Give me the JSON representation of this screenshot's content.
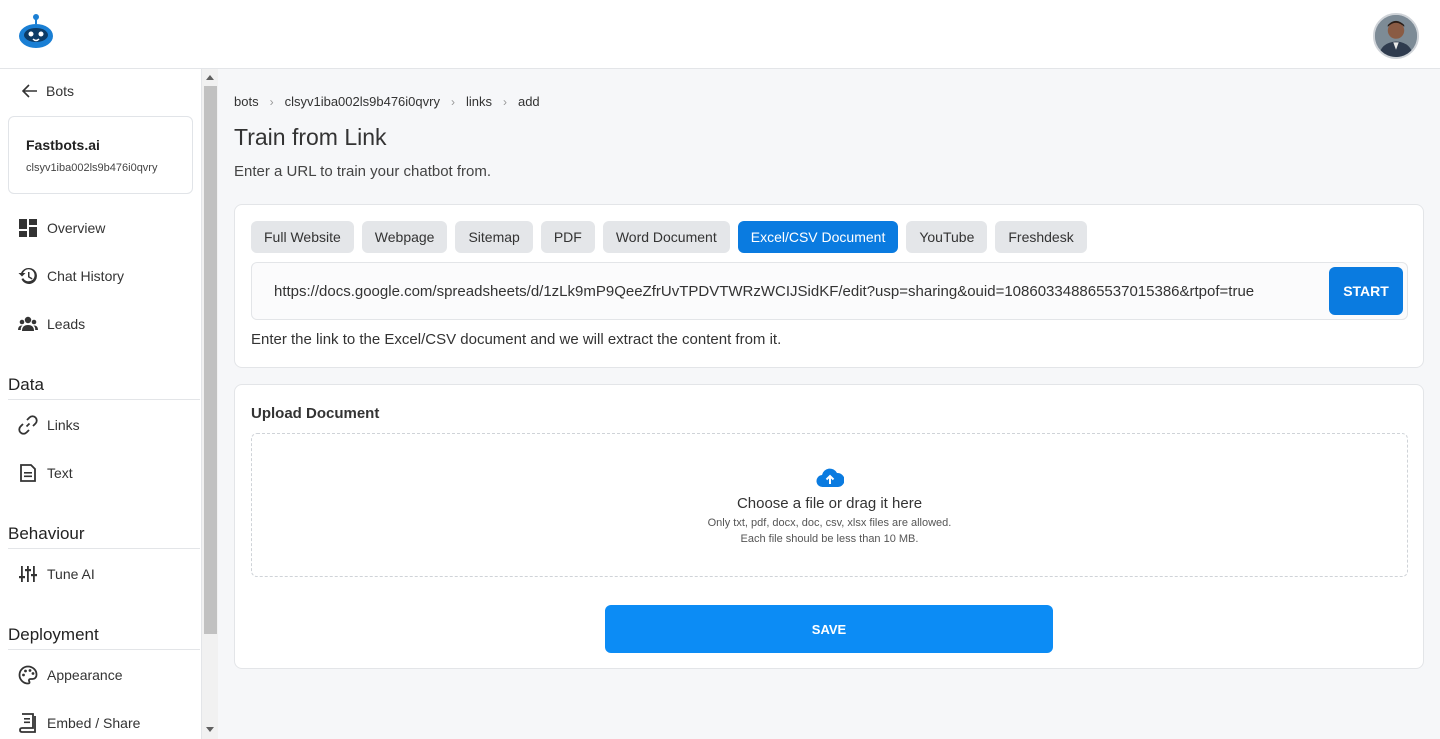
{
  "sidebar": {
    "back_label": "Bots",
    "bot": {
      "name": "Fastbots.ai",
      "id": "clsyv1iba002ls9b476i0qvry"
    },
    "items": [
      {
        "label": "Overview",
        "icon": "dashboard-icon"
      },
      {
        "label": "Chat History",
        "icon": "history-icon"
      },
      {
        "label": "Leads",
        "icon": "people-icon"
      }
    ],
    "sections": {
      "data": {
        "title": "Data",
        "items": [
          {
            "label": "Links",
            "icon": "link-icon"
          },
          {
            "label": "Text",
            "icon": "document-icon"
          }
        ]
      },
      "behaviour": {
        "title": "Behaviour",
        "items": [
          {
            "label": "Tune AI",
            "icon": "sliders-icon"
          }
        ]
      },
      "deployment": {
        "title": "Deployment",
        "items": [
          {
            "label": "Appearance",
            "icon": "palette-icon"
          },
          {
            "label": "Embed / Share",
            "icon": "embed-icon"
          }
        ]
      }
    }
  },
  "breadcrumb": [
    "bots",
    "clsyv1iba002ls9b476i0qvry",
    "links",
    "add"
  ],
  "page": {
    "title": "Train from Link",
    "subtitle": "Enter a URL to train your chatbot from."
  },
  "source_tabs": {
    "items": [
      "Full Website",
      "Webpage",
      "Sitemap",
      "PDF",
      "Word Document",
      "Excel/CSV Document",
      "YouTube",
      "Freshdesk"
    ],
    "active": "Excel/CSV Document"
  },
  "url_input": {
    "value": "https://docs.google.com/spreadsheets/d/1zLk9mP9QeeZfrUvTPDVTWRzWCIJSidKF/edit?usp=sharing&ouid=108603348865537015386&rtpof=true",
    "start_label": "START",
    "helper": "Enter the link to the Excel/CSV document and we will extract the content from it."
  },
  "upload": {
    "title": "Upload Document",
    "main": "Choose a file or drag it here",
    "note1": "Only txt, pdf, docx, doc, csv, xlsx files are allowed.",
    "note2": "Each file should be less than 10 MB.",
    "save_label": "SAVE"
  },
  "colors": {
    "accent": "#0a7be0",
    "save": "#0c8cf5"
  }
}
